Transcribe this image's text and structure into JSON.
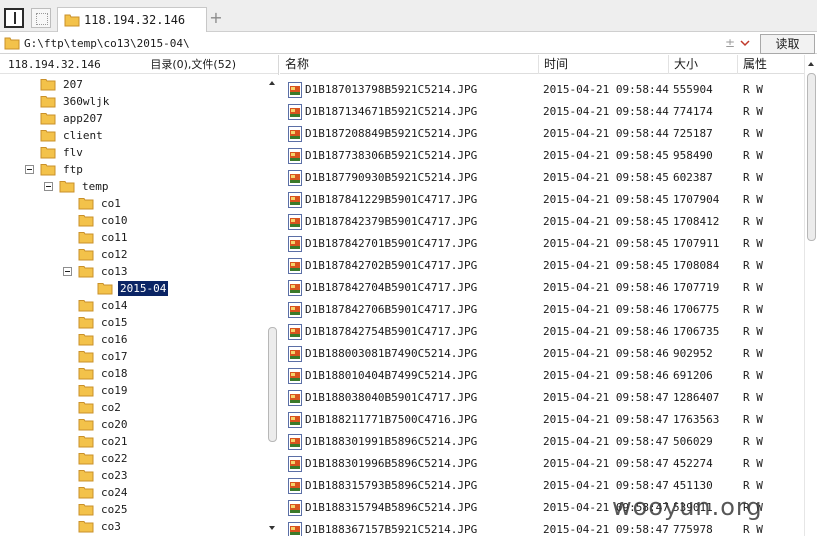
{
  "tab": {
    "title": "118.194.32.146",
    "add_label": "+"
  },
  "address": {
    "path": "G:\\ftp\\temp\\co13\\2015-04\\",
    "plus_label": "±",
    "read_label": "读取"
  },
  "left": {
    "host": "118.194.32.146",
    "summary": "目录(0),文件(52)",
    "tree": [
      {
        "label": "207",
        "depth": 0,
        "expander": "none"
      },
      {
        "label": "360wljk",
        "depth": 0,
        "expander": "none"
      },
      {
        "label": "app207",
        "depth": 0,
        "expander": "none"
      },
      {
        "label": "client",
        "depth": 0,
        "expander": "none"
      },
      {
        "label": "flv",
        "depth": 0,
        "expander": "none"
      },
      {
        "label": "ftp",
        "depth": 0,
        "expander": "minus"
      },
      {
        "label": "temp",
        "depth": 1,
        "expander": "minus"
      },
      {
        "label": "co1",
        "depth": 2,
        "expander": "none"
      },
      {
        "label": "co10",
        "depth": 2,
        "expander": "none"
      },
      {
        "label": "co11",
        "depth": 2,
        "expander": "none"
      },
      {
        "label": "co12",
        "depth": 2,
        "expander": "none"
      },
      {
        "label": "co13",
        "depth": 2,
        "expander": "minus"
      },
      {
        "label": "2015-04",
        "depth": 3,
        "expander": "none",
        "selected": true
      },
      {
        "label": "co14",
        "depth": 2,
        "expander": "none"
      },
      {
        "label": "co15",
        "depth": 2,
        "expander": "none"
      },
      {
        "label": "co16",
        "depth": 2,
        "expander": "none"
      },
      {
        "label": "co17",
        "depth": 2,
        "expander": "none"
      },
      {
        "label": "co18",
        "depth": 2,
        "expander": "none"
      },
      {
        "label": "co19",
        "depth": 2,
        "expander": "none"
      },
      {
        "label": "co2",
        "depth": 2,
        "expander": "none"
      },
      {
        "label": "co20",
        "depth": 2,
        "expander": "none"
      },
      {
        "label": "co21",
        "depth": 2,
        "expander": "none"
      },
      {
        "label": "co22",
        "depth": 2,
        "expander": "none"
      },
      {
        "label": "co23",
        "depth": 2,
        "expander": "none"
      },
      {
        "label": "co24",
        "depth": 2,
        "expander": "none"
      },
      {
        "label": "co25",
        "depth": 2,
        "expander": "none"
      },
      {
        "label": "co3",
        "depth": 2,
        "expander": "none"
      }
    ]
  },
  "files": {
    "columns": {
      "name": "名称",
      "time": "时间",
      "size": "大小",
      "attr": "属性"
    },
    "rows": [
      {
        "name": "D1B187013798B5921C5214.JPG",
        "time": "2015-04-21 09:58:44",
        "size": "555904",
        "attr": "R W"
      },
      {
        "name": "D1B187134671B5921C5214.JPG",
        "time": "2015-04-21 09:58:44",
        "size": "774174",
        "attr": "R W"
      },
      {
        "name": "D1B187208849B5921C5214.JPG",
        "time": "2015-04-21 09:58:44",
        "size": "725187",
        "attr": "R W"
      },
      {
        "name": "D1B187738306B5921C5214.JPG",
        "time": "2015-04-21 09:58:45",
        "size": "958490",
        "attr": "R W"
      },
      {
        "name": "D1B187790930B5921C5214.JPG",
        "time": "2015-04-21 09:58:45",
        "size": "602387",
        "attr": "R W"
      },
      {
        "name": "D1B187841229B5901C4717.JPG",
        "time": "2015-04-21 09:58:45",
        "size": "1707904",
        "attr": "R W"
      },
      {
        "name": "D1B187842379B5901C4717.JPG",
        "time": "2015-04-21 09:58:45",
        "size": "1708412",
        "attr": "R W"
      },
      {
        "name": "D1B187842701B5901C4717.JPG",
        "time": "2015-04-21 09:58:45",
        "size": "1707911",
        "attr": "R W"
      },
      {
        "name": "D1B187842702B5901C4717.JPG",
        "time": "2015-04-21 09:58:45",
        "size": "1708084",
        "attr": "R W"
      },
      {
        "name": "D1B187842704B5901C4717.JPG",
        "time": "2015-04-21 09:58:46",
        "size": "1707719",
        "attr": "R W"
      },
      {
        "name": "D1B187842706B5901C4717.JPG",
        "time": "2015-04-21 09:58:46",
        "size": "1706775",
        "attr": "R W"
      },
      {
        "name": "D1B187842754B5901C4717.JPG",
        "time": "2015-04-21 09:58:46",
        "size": "1706735",
        "attr": "R W"
      },
      {
        "name": "D1B188003081B7490C5214.JPG",
        "time": "2015-04-21 09:58:46",
        "size": "902952",
        "attr": "R W"
      },
      {
        "name": "D1B188010404B7499C5214.JPG",
        "time": "2015-04-21 09:58:46",
        "size": "691206",
        "attr": "R W"
      },
      {
        "name": "D1B188038040B5901C4717.JPG",
        "time": "2015-04-21 09:58:47",
        "size": "1286407",
        "attr": "R W"
      },
      {
        "name": "D1B188211771B7500C4716.JPG",
        "time": "2015-04-21 09:58:47",
        "size": "1763563",
        "attr": "R W"
      },
      {
        "name": "D1B188301991B5896C5214.JPG",
        "time": "2015-04-21 09:58:47",
        "size": "506029",
        "attr": "R W"
      },
      {
        "name": "D1B188301996B5896C5214.JPG",
        "time": "2015-04-21 09:58:47",
        "size": "452274",
        "attr": "R W"
      },
      {
        "name": "D1B188315793B5896C5214.JPG",
        "time": "2015-04-21 09:58:47",
        "size": "451130",
        "attr": "R W"
      },
      {
        "name": "D1B188315794B5896C5214.JPG",
        "time": "2015-04-21 09:58:47",
        "size": "539011",
        "attr": "R W"
      },
      {
        "name": "D1B188367157B5921C5214.JPG",
        "time": "2015-04-21 09:58:47",
        "size": "775978",
        "attr": "R W"
      }
    ]
  },
  "watermark": "wooyun.org",
  "colors": {
    "selection": "#0a2464",
    "folder": "#f3c24a",
    "folder_edge": "#c9902a",
    "file_icon": "#d9531e"
  },
  "icons": {
    "tab": "folder-icon",
    "address": "folder-icon",
    "tree": "folder-icon",
    "file": "image-file-icon",
    "dropdown": "chevron-down-icon"
  }
}
